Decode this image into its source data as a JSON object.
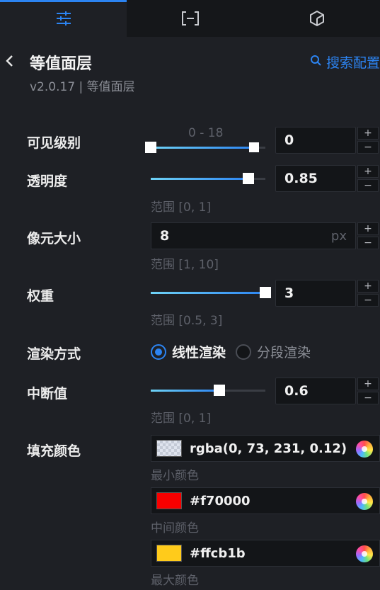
{
  "tabs": [
    {
      "icon": "sliders-icon",
      "active": true
    },
    {
      "icon": "bracket-minus-icon",
      "active": false
    },
    {
      "icon": "cube-icon",
      "active": false
    }
  ],
  "header": {
    "title": "等值面层",
    "subtitle": "v2.0.17 | 等值面层",
    "search_label": "搜索配置"
  },
  "fields": {
    "visible_level": {
      "label": "可见级别",
      "range_text": "0 - 18",
      "value": "0",
      "range_min": 0,
      "range_max": 18,
      "handle_low": 0,
      "handle_high": 18
    },
    "opacity": {
      "label": "透明度",
      "value": "0.85",
      "hint": "范围 [0, 1]",
      "fraction": 0.85
    },
    "pixel_size": {
      "label": "像元大小",
      "value": "8",
      "unit": "px",
      "hint": "范围 [1, 10]"
    },
    "weight": {
      "label": "权重",
      "value": "3",
      "hint": "范围 [0.5, 3]",
      "fraction": 1.0
    },
    "render_mode": {
      "label": "渲染方式",
      "option_linear": "线性渲染",
      "option_segment": "分段渲染",
      "selected": "线性渲染"
    },
    "breakpoint": {
      "label": "中断值",
      "value": "0.6",
      "hint": "范围 [0, 1]",
      "fraction": 0.6
    },
    "fill_color": {
      "label": "填充颜色",
      "min": {
        "value": "rgba(0, 73, 231, 0.12)",
        "caption": "最小颜色"
      },
      "mid": {
        "value": "#f70000",
        "caption": "中间颜色",
        "color": "#f70000"
      },
      "max": {
        "value": "#ffcb1b",
        "caption": "最大颜色",
        "color": "#ffcb1b"
      }
    }
  },
  "stepper": {
    "plus": "+",
    "minus": "−"
  }
}
